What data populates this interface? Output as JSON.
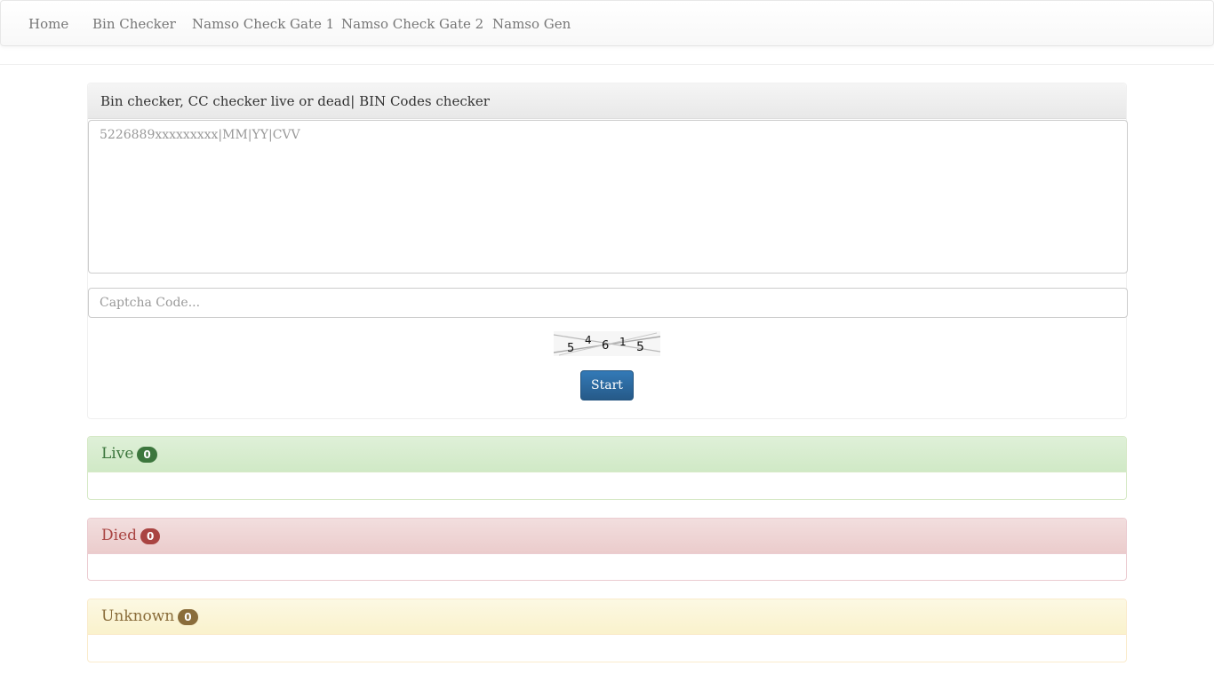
{
  "nav": {
    "items": [
      {
        "label": "Home"
      },
      {
        "label": "Bin Checker"
      },
      {
        "label": "Namso Check Gate 1"
      },
      {
        "label": "Namso Check Gate 2"
      },
      {
        "label": "Namso Gen"
      }
    ]
  },
  "checker": {
    "title": "Bin checker, CC checker live or dead| BIN Codes checker",
    "cards_placeholder": "5226889xxxxxxxxx|MM|YY|CVV",
    "cards_value": "",
    "captcha_placeholder": "Captcha Code...",
    "captcha_value": "",
    "captcha_chars": [
      "5",
      "4",
      "6",
      "1",
      "5"
    ],
    "start_label": "Start"
  },
  "results": {
    "live": {
      "label": "Live",
      "count": "0",
      "color": "#3c763d"
    },
    "died": {
      "label": "Died",
      "count": "0",
      "color": "#a94442"
    },
    "unknown": {
      "label": "Unknown",
      "count": "0",
      "color": "#8a6d3b"
    }
  }
}
